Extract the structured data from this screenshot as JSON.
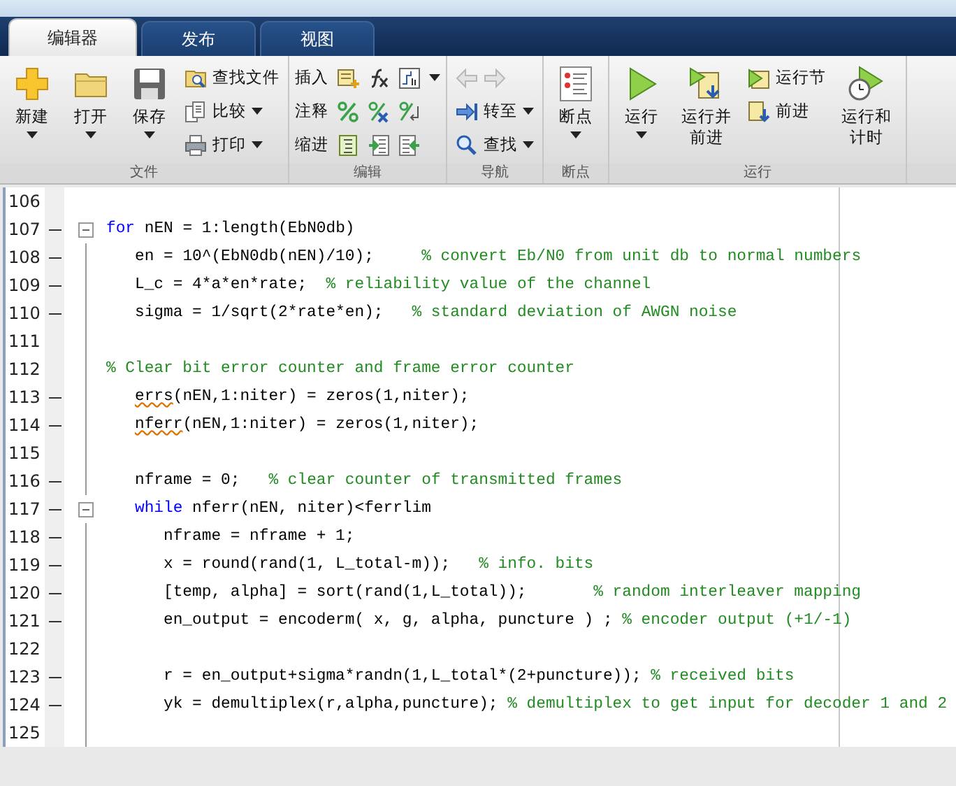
{
  "tabs": [
    {
      "label": "编辑器",
      "selected": true
    },
    {
      "label": "发布",
      "selected": false
    },
    {
      "label": "视图",
      "selected": false
    }
  ],
  "ribbon": {
    "groups": [
      {
        "label": "文件",
        "items": [
          {
            "kind": "large",
            "label": "新建",
            "dropdown": true
          },
          {
            "kind": "large",
            "label": "打开",
            "dropdown": true
          },
          {
            "kind": "large",
            "label": "保存",
            "dropdown": true
          },
          {
            "kind": "stack",
            "rows": [
              {
                "label": "查找文件",
                "dropdown": false
              },
              {
                "label": "比较",
                "dropdown": true
              },
              {
                "label": "打印",
                "dropdown": true
              }
            ]
          }
        ]
      },
      {
        "label": "编辑",
        "items": [
          {
            "kind": "tools",
            "rows": [
              {
                "label": "插入",
                "dropdown": true
              },
              {
                "label": "注释",
                "dropdown": false
              },
              {
                "label": "缩进",
                "dropdown": false
              }
            ]
          }
        ]
      },
      {
        "label": "导航",
        "items": [
          {
            "kind": "stack",
            "rows": [
              {
                "disabled": true,
                "dropdown": false
              },
              {
                "label": "转至",
                "dropdown": true
              },
              {
                "label": "查找",
                "dropdown": true
              }
            ]
          }
        ]
      },
      {
        "label": "断点",
        "items": [
          {
            "kind": "large",
            "label": "断点",
            "dropdown": true
          }
        ]
      },
      {
        "label": "运行",
        "items": [
          {
            "kind": "large",
            "label": "运行",
            "dropdown": true
          },
          {
            "kind": "large",
            "label": "运行并前进",
            "dropdown": false
          },
          {
            "kind": "stack",
            "rows": [
              {
                "label": "运行节",
                "dropdown": false
              },
              {
                "label": "前进",
                "dropdown": false
              }
            ]
          },
          {
            "kind": "large",
            "label": "运行和计时",
            "dropdown": false
          }
        ]
      }
    ]
  },
  "editor": {
    "lines": [
      {
        "number": "106",
        "executable": false,
        "foldable": false
      },
      {
        "number": "107",
        "executable": true,
        "foldable": true,
        "code": [
          {
            "kind": "keyword",
            "text": "for"
          },
          {
            "kind": "plain",
            "text": " nEN = 1:length(EbN0db)"
          }
        ]
      },
      {
        "number": "108",
        "executable": true,
        "foldable": false,
        "code": [
          {
            "kind": "plain",
            "text": "   en = 10^(EbN0db(nEN)/10);     "
          },
          {
            "kind": "comment",
            "text": "% convert Eb/N0 from unit db to normal numbers"
          }
        ]
      },
      {
        "number": "109",
        "executable": true,
        "foldable": false,
        "code": [
          {
            "kind": "plain",
            "text": "   L_c = 4*a*en*rate;  "
          },
          {
            "kind": "comment",
            "text": "% reliability value of the channel"
          }
        ]
      },
      {
        "number": "110",
        "executable": true,
        "foldable": false,
        "code": [
          {
            "kind": "plain",
            "text": "   sigma = 1/sqrt(2*rate*en);   "
          },
          {
            "kind": "comment",
            "text": "% standard deviation of AWGN noise"
          }
        ]
      },
      {
        "number": "111",
        "executable": false,
        "foldable": false
      },
      {
        "number": "112",
        "executable": false,
        "foldable": false,
        "code": [
          {
            "kind": "comment",
            "text": "% Clear bit error counter and frame error counter"
          }
        ]
      },
      {
        "number": "113",
        "executable": true,
        "foldable": false,
        "code": [
          {
            "kind": "warning",
            "text": "   errs"
          },
          {
            "kind": "plain",
            "text": "(nEN,1:niter) = zeros(1,niter);"
          }
        ]
      },
      {
        "number": "114",
        "executable": true,
        "foldable": false,
        "code": [
          {
            "kind": "warning",
            "text": "   nferr"
          },
          {
            "kind": "plain",
            "text": "(nEN,1:niter) = zeros(1,niter);"
          }
        ]
      },
      {
        "number": "115",
        "executable": false,
        "foldable": false
      },
      {
        "number": "116",
        "executable": true,
        "foldable": false,
        "code": [
          {
            "kind": "plain",
            "text": "   nframe = 0;   "
          },
          {
            "kind": "comment",
            "text": "% clear counter of transmitted frames"
          }
        ]
      },
      {
        "number": "117",
        "executable": true,
        "foldable": true,
        "code": [
          {
            "kind": "keyword",
            "text": "   while"
          },
          {
            "kind": "plain",
            "text": " nferr(nEN, niter)<ferrlim"
          }
        ]
      },
      {
        "number": "118",
        "executable": true,
        "foldable": false,
        "code": [
          {
            "kind": "plain",
            "text": "      nframe = nframe + 1;"
          }
        ]
      },
      {
        "number": "119",
        "executable": true,
        "foldable": false,
        "code": [
          {
            "kind": "plain",
            "text": "      x = round(rand(1, L_total-m));   "
          },
          {
            "kind": "comment",
            "text": "% info. bits"
          }
        ]
      },
      {
        "number": "120",
        "executable": true,
        "foldable": false,
        "code": [
          {
            "kind": "plain",
            "text": "      [temp, alpha] = sort(rand(1,L_total));       "
          },
          {
            "kind": "comment",
            "text": "% random interleaver mapping"
          }
        ]
      },
      {
        "number": "121",
        "executable": true,
        "foldable": false,
        "code": [
          {
            "kind": "plain",
            "text": "      en_output = encoderm( x, g, alpha, puncture ) ; "
          },
          {
            "kind": "comment",
            "text": "% encoder output (+1/-1)"
          }
        ]
      },
      {
        "number": "122",
        "executable": false,
        "foldable": false
      },
      {
        "number": "123",
        "executable": true,
        "foldable": false,
        "code": [
          {
            "kind": "plain",
            "text": "      r = en_output+sigma*randn(1,L_total*(2+puncture)); "
          },
          {
            "kind": "comment",
            "text": "% received bits"
          }
        ]
      },
      {
        "number": "124",
        "executable": true,
        "foldable": false,
        "code": [
          {
            "kind": "plain",
            "text": "      yk = demultiplex(r,alpha,puncture); "
          },
          {
            "kind": "comment",
            "text": "% demultiplex to get input for decoder 1 and 2"
          }
        ]
      },
      {
        "number": "125",
        "executable": false,
        "foldable": false
      }
    ]
  }
}
